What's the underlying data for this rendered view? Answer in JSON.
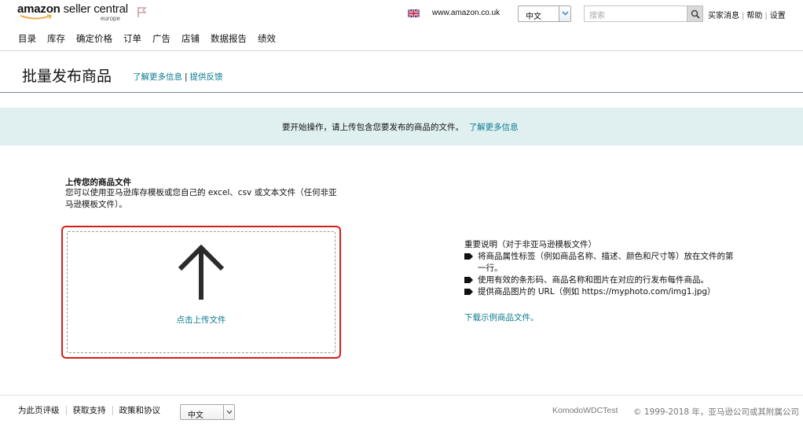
{
  "header": {
    "logo_text_light": "amazon",
    "logo_text_main": " seller central",
    "logo_sub": "europe",
    "marketplace": "www.amazon.co.uk",
    "language": "中文",
    "search_placeholder": "搜索",
    "links": [
      "买家消息",
      "帮助",
      "设置"
    ]
  },
  "nav": {
    "items": [
      "目录",
      "库存",
      "确定价格",
      "订单",
      "广告",
      "店铺",
      "数据报告",
      "绩效"
    ]
  },
  "page": {
    "title": "批量发布商品",
    "learn_more": "了解更多信息",
    "feedback": "提供反馈"
  },
  "banner": {
    "text": "要开始操作，请上传包含您要发布的商品的文件。",
    "link": "了解更多信息"
  },
  "upload": {
    "heading": "上传您的商品文件",
    "description": "您可以使用亚马逊库存模板或您自己的 excel、csv 或文本文件（任何非亚马逊模板文件）。",
    "dropzone_label": "点击上传文件"
  },
  "notes": {
    "title": "重要说明（对于非亚马逊模板文件）",
    "items": [
      "将商品属性标签（例如商品名称、描述、颜色和尺寸等）放在文件的第一行。",
      "使用有效的条形码、商品名称和图片在对应的行发布每件商品。",
      "提供商品图片的 URL（例如 https://myphoto.com/img1.jpg）"
    ],
    "download_link": "下载示例商品文件。"
  },
  "footer": {
    "links": [
      "为此页评级",
      "获取支持",
      "政策和协议"
    ],
    "language": "中文",
    "account": "KomodoWDCTest",
    "copyright": "© 1999-2018 年，亚马逊公司或其附属公司"
  },
  "colors": {
    "link": "#0a7a8f",
    "banner_bg": "#e0f0f1",
    "highlight_border": "#d91b1b",
    "smile": "#f3a847"
  }
}
